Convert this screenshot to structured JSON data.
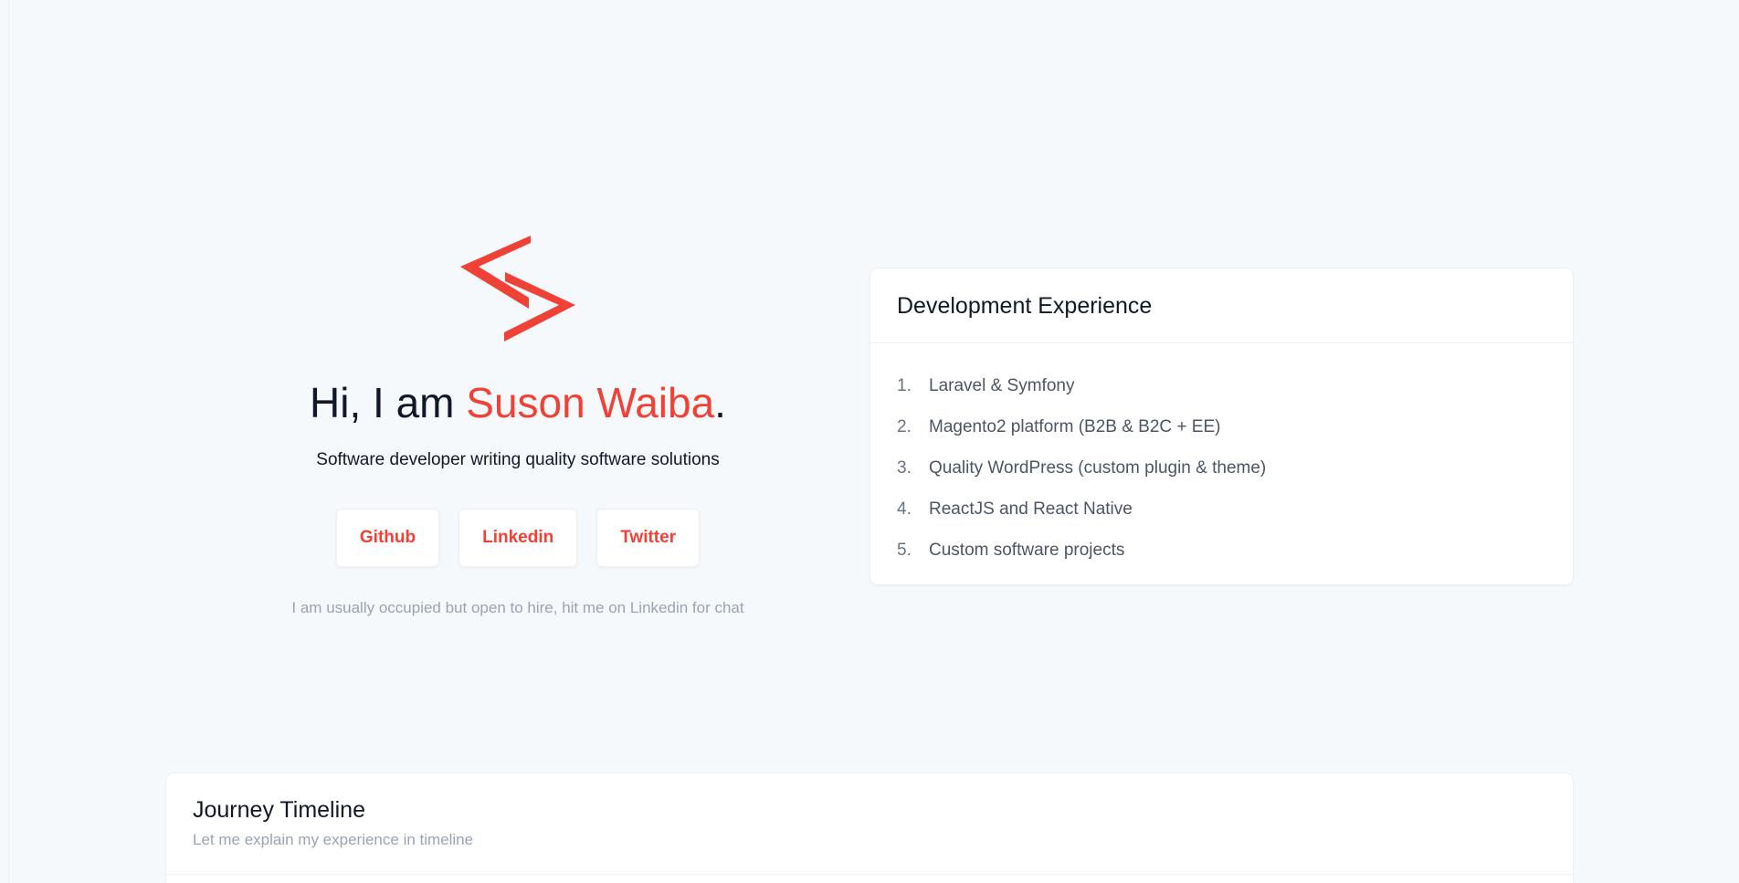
{
  "hero": {
    "greeting": "Hi, I am ",
    "name": "Suson Waiba",
    "period": ".",
    "subtitle": "Software developer writing quality software solutions",
    "note": "I am usually occupied but open to hire, hit me on Linkedin for chat",
    "logo_icon": "code-brackets-logo",
    "accent_color": "#ef4136"
  },
  "social": {
    "buttons": [
      {
        "label": "Github"
      },
      {
        "label": "Linkedin"
      },
      {
        "label": "Twitter"
      }
    ]
  },
  "experience": {
    "title": "Development Experience",
    "items": [
      {
        "num": "1.",
        "text": "Laravel & Symfony"
      },
      {
        "num": "2.",
        "text": "Magento2 platform (B2B & B2C + EE)"
      },
      {
        "num": "3.",
        "text": "Quality WordPress (custom plugin & theme)"
      },
      {
        "num": "4.",
        "text": "ReactJS and React Native"
      },
      {
        "num": "5.",
        "text": "Custom software projects"
      }
    ]
  },
  "journey": {
    "title": "Journey Timeline",
    "subtitle": "Let me explain my experience in timeline"
  }
}
